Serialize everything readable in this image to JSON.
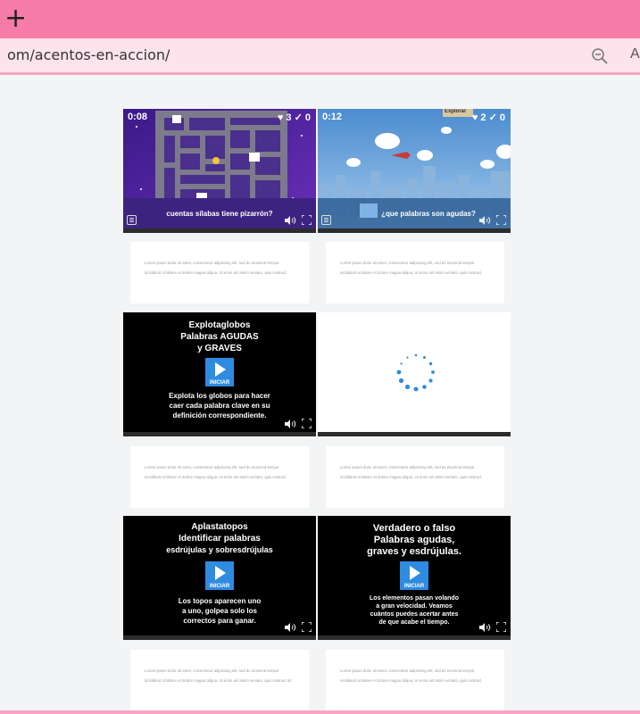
{
  "browser": {
    "new_tab_symbol": "+",
    "url_text": "om/acentos-en-accion/",
    "zoom_icon": "zoom-out-icon",
    "reader_label": "A"
  },
  "games": [
    {
      "timer": "0:08",
      "likes": "♥ 3 ✓ 0",
      "question": "cuentas sílabas tiene pizarrón?"
    },
    {
      "timer": "0:12",
      "likes": "♥ 2 ✓ 0",
      "question": "¿que palabras son agudas?",
      "banner": "Explorar"
    },
    {
      "title_lines": [
        "Explotaglobos",
        "Palabras AGUDAS",
        "y GRAVES"
      ],
      "play_label": "INICIAR",
      "description_lines": [
        "Explota los globos para hacer",
        "caer cada palabra clave en su",
        "definición correspondiente."
      ]
    },
    {
      "state": "loading"
    },
    {
      "title_lines": [
        "Aplastatopos",
        "Identificar palabras",
        "esdrújulas y sobresdrújulas"
      ],
      "play_label": "INICIAR",
      "description_lines": [
        "Los topos aparecen uno",
        "a uno, golpea solo los",
        "correctos para ganar."
      ]
    },
    {
      "title_lines": [
        "Verdadero o falso",
        "Palabras agudas,",
        "graves y esdrújulas."
      ],
      "play_label": "INICIAR",
      "description_lines": [
        "Los elementos pasan volando",
        "a gran velocidad. Veamos",
        "cuántos puedes acertar antes",
        "de que acabe el tiempo."
      ]
    }
  ],
  "cards": [
    "Lorem ipsum dolor sit amet, consectetur adipiscing elit, sed do eiusmod tempor incididunt ut labore et dolore magna aliqua. Ut enim ad minim veniam, quis nostrud.",
    "Lorem ipsum dolor sit amet, consectetur adipiscing elit, sed do eiusmod tempor incididunt ut labore et dolore magna aliqua. Ut enim ad minim veniam, quis nostrud.",
    "Lorem ipsum dolor sit amet, consectetur adipiscing elit, sed do eiusmod tempor incididunt ut labore et dolore magna aliqua. Ut enim ad minim veniam, quis nostrud.",
    "Lorem ipsum dolor sit amet, consectetur adipiscing elit, sed do eiusmod tempor incididunt ut labore et dolore magna aliqua. Ut enim ad minim veniam, quis nostrud.",
    "Lorem ipsum dolor sit amet, consectetur adipiscing elit, sed do eiusmod tempor incididunt ut labore et dolore magna aliqua. Ut enim ad minim veniam, quis nostrud, sit.",
    "Lorem ipsum dolor sit amet, consectetur adipiscing elit, sed do eiusmod tempor incididunt ut labore et dolore magna aliqua. Ut enim ad minim veniam, quis nostrud."
  ],
  "colors": {
    "tab_bar": "#f77ca7",
    "address_bar": "#fde4ec",
    "play_button": "#2e8be0",
    "spinner": "#2e8be0"
  }
}
